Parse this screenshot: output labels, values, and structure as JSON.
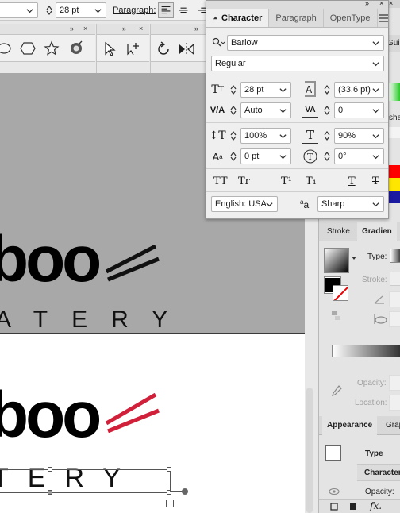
{
  "control_bar": {
    "font_size_value": "28 pt",
    "paragraph_label": "Paragraph:"
  },
  "tool_panels": {
    "collapse_glyph": "»",
    "close_glyph": "×"
  },
  "character_panel": {
    "tabs": [
      "Character",
      "Paragraph",
      "OpenType"
    ],
    "font_family": "Barlow",
    "font_style": "Regular",
    "font_size": "28 pt",
    "leading": "(33.6 pt)",
    "kerning": "Auto",
    "tracking": "0",
    "vertical_scale": "100%",
    "horizontal_scale": "90%",
    "baseline_shift": "0 pt",
    "rotation": "0°",
    "language": "English: USA",
    "antialias_label": "a",
    "antialias": "Sharp",
    "style_buttons": [
      "TT",
      "Tr",
      "T¹",
      "T₁",
      "T",
      "T"
    ]
  },
  "dock": {
    "top_tab_partial": "Gui",
    "side_tab_partial": "she",
    "stroke_tab": "Stroke",
    "gradient_tab": "Gradien",
    "type_label": "Type:",
    "stroke_label": "Stroke:",
    "opacity_label": "Opacity:",
    "location_label": "Location:",
    "appearance_tab": "Appearance",
    "graphic_tab_partial": "Grap",
    "appearance_type": "Type",
    "appearance_characters": "Characters",
    "appearance_opacity": "Opacity:",
    "fx_label": "fx.",
    "swatch_colors": [
      "#ff0000",
      "#ffe600",
      "#1a1aa0"
    ]
  },
  "artwork": {
    "word_top": "boo",
    "subtitle_top": "ATERY",
    "word_bottom": "boo",
    "subtitle_bottom": "TERY",
    "chopstick_color_top": "#111111",
    "chopstick_color_bottom": "#d0203a"
  }
}
